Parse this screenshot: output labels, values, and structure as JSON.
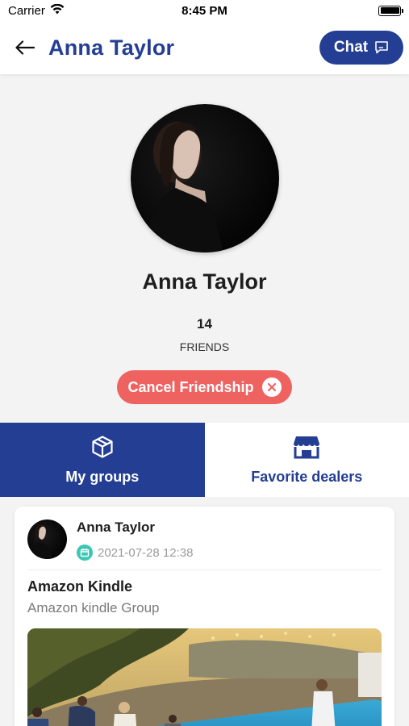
{
  "status_bar": {
    "carrier": "Carrier",
    "time": "8:45 PM"
  },
  "header": {
    "title": "Anna Taylor",
    "chat_label": "Chat"
  },
  "profile": {
    "name": "Anna Taylor",
    "friends_count": "14",
    "friends_label": "FRIENDS",
    "cancel_label": "Cancel Friendship"
  },
  "tabs": [
    {
      "label": "My groups",
      "icon": "box-icon",
      "active": true
    },
    {
      "label": "Favorite dealers",
      "icon": "store-icon",
      "active": false
    }
  ],
  "post": {
    "author": "Anna Taylor",
    "date": "2021-07-28 12:38",
    "title": "Amazon Kindle",
    "subtitle": "Amazon kindle Group"
  },
  "colors": {
    "primary": "#233e93",
    "danger": "#ee6260",
    "accent": "#3cc7b4",
    "background": "#f3f3f3"
  }
}
